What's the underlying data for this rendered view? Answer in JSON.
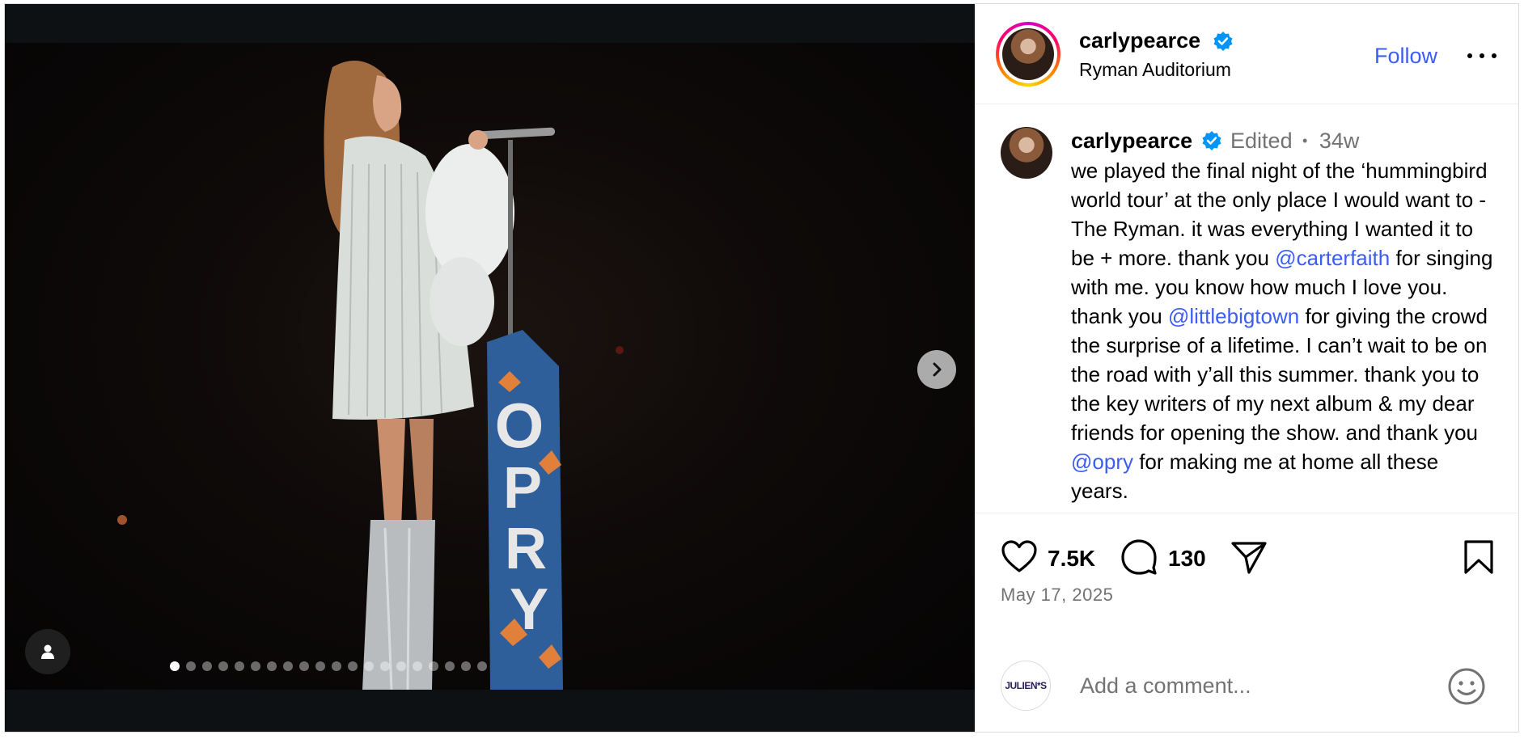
{
  "post": {
    "username": "carlypearce",
    "location": "Ryman Auditorium",
    "follow_label": "Follow",
    "edited_label": "Edited",
    "separator": "•",
    "age": "34w",
    "caption_parts": [
      "we played the final night of the ‘hummingbird world tour’ at the only place I would want to - The Ryman. it was everything I wanted it to be + more. thank you ",
      "@carterfaith",
      " for singing with me. you know how much I love you. thank you ",
      "@littlebigtown",
      " for giving the crowd the surprise of a lifetime. I can’t wait to be on the road with y’all this summer. thank you to the key writers of my next album & my dear friends for opening the show. and thank you ",
      "@opry",
      " for making me at home all these years."
    ],
    "likes": "7.5K",
    "comments": "130",
    "date": "May 17, 2025",
    "comment_placeholder": "Add a comment...",
    "commenter_avatar_text": "JULIEN*S",
    "sign_text": "OPRY",
    "carousel": {
      "total": 20,
      "active_index": 0
    }
  },
  "colors": {
    "link": "#3b5cf5",
    "verified": "#0095f6",
    "muted": "#737373",
    "media_bg": "#0d1114"
  },
  "icons": [
    "next-arrow-icon",
    "tagged-user-icon",
    "verified-badge-icon",
    "more-options-icon",
    "heart-icon",
    "comment-icon",
    "share-icon",
    "bookmark-icon",
    "emoji-icon"
  ]
}
